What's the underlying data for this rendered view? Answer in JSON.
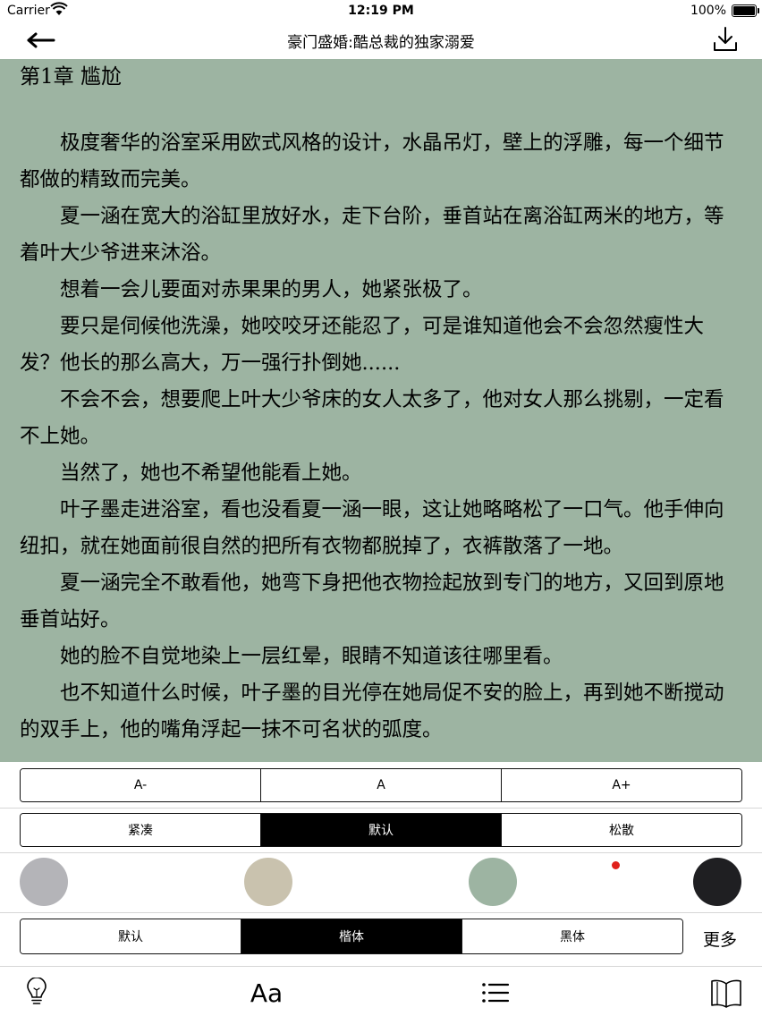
{
  "status_bar": {
    "carrier": "Carrier",
    "time": "12:19 PM",
    "battery": "100%"
  },
  "nav": {
    "title": "豪门盛婚:酷总裁的独家溺爱",
    "back_icon": "back-arrow-icon",
    "download_icon": "download-icon"
  },
  "chapter": {
    "title": "第1章 尴尬",
    "paragraphs": [
      "极度奢华的浴室采用欧式风格的设计，水晶吊灯，壁上的浮雕，每一个细节都做的精致而完美。",
      "夏一涵在宽大的浴缸里放好水，走下台阶，垂首站在离浴缸两米的地方，等着叶大少爷进来沐浴。",
      "想着一会儿要面对赤果果的男人，她紧张极了。",
      "要只是伺候他洗澡，她咬咬牙还能忍了，可是谁知道他会不会忽然瘦性大发？他长的那么高大，万一强行扑倒她......",
      "不会不会，想要爬上叶大少爷床的女人太多了，他对女人那么挑剔，一定看不上她。",
      "当然了，她也不希望他能看上她。",
      "叶子墨走进浴室，看也没看夏一涵一眼，这让她略略松了一口气。他手伸向纽扣，就在她面前很自然的把所有衣物都脱掉了，衣裤散落了一地。",
      "夏一涵完全不敢看他，她弯下身把他衣物捡起放到专门的地方，又回到原地垂首站好。",
      "她的脸不自觉地染上一层红晕，眼睛不知道该往哪里看。",
      "也不知道什么时候，叶子墨的目光停在她局促不安的脸上，再到她不断搅动的双手上，他的嘴角浮起一抹不可名状的弧度。"
    ]
  },
  "settings": {
    "font_size": {
      "options": [
        "A-",
        "A",
        "A+"
      ]
    },
    "spacing": {
      "options": [
        "紧凑",
        "默认",
        "松散"
      ],
      "selected": "默认"
    },
    "themes": {
      "colors": [
        "#b4b4b8",
        "#c9c2ae",
        "#9db4a2",
        "#1f1f22"
      ],
      "selected_index": 2,
      "indicator_color": "#e0201b"
    },
    "font_family": {
      "options": [
        "默认",
        "楷体",
        "黑体"
      ],
      "selected": "楷体",
      "more_label": "更多"
    },
    "reader_background": "#9db4a2"
  },
  "toolbar": {
    "items": [
      {
        "icon": "lightbulb-icon"
      },
      {
        "label": "Aa",
        "icon": "font-settings-icon"
      },
      {
        "icon": "table-of-contents-icon"
      },
      {
        "icon": "book-icon"
      }
    ]
  }
}
